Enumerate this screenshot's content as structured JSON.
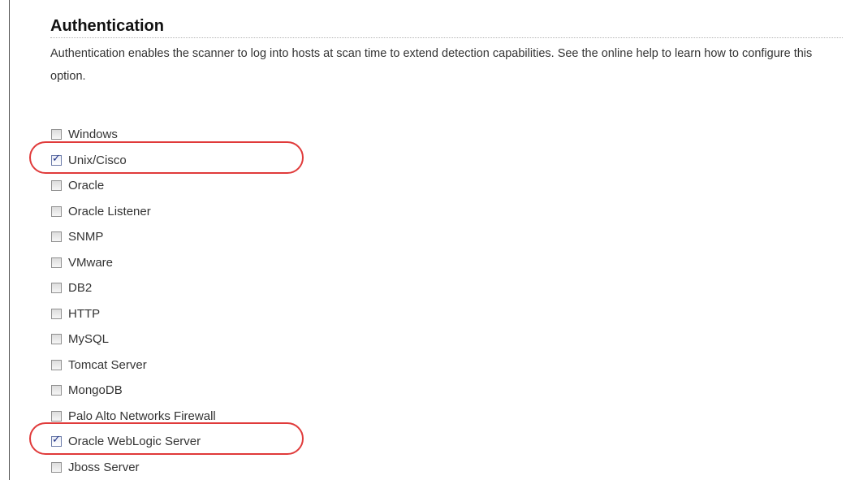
{
  "section": {
    "title": "Authentication",
    "description": "Authentication enables the scanner to log into hosts at scan time to extend detection capabilities. See the online help to learn how to configure this option."
  },
  "options": [
    {
      "label": "Windows",
      "checked": false
    },
    {
      "label": "Unix/Cisco",
      "checked": true
    },
    {
      "label": "Oracle",
      "checked": false
    },
    {
      "label": "Oracle Listener",
      "checked": false
    },
    {
      "label": "SNMP",
      "checked": false
    },
    {
      "label": "VMware",
      "checked": false
    },
    {
      "label": "DB2",
      "checked": false
    },
    {
      "label": "HTTP",
      "checked": false
    },
    {
      "label": "MySQL",
      "checked": false
    },
    {
      "label": "Tomcat Server",
      "checked": false
    },
    {
      "label": "MongoDB",
      "checked": false
    },
    {
      "label": "Palo Alto Networks Firewall",
      "checked": false
    },
    {
      "label": "Oracle WebLogic Server",
      "checked": true
    },
    {
      "label": "Jboss Server",
      "checked": false
    }
  ],
  "annotations": {
    "highlight_color": "#e03a3a",
    "highlighted_options": [
      "Unix/Cisco",
      "Oracle WebLogic Server"
    ]
  }
}
